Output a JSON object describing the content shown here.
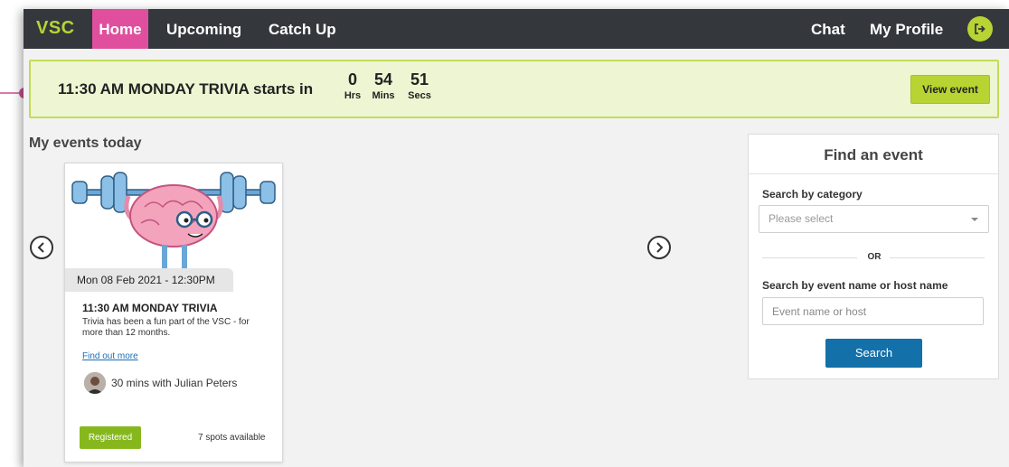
{
  "nav": {
    "logo": "VSC",
    "links": [
      "Home",
      "Upcoming",
      "Catch Up"
    ],
    "right_links": [
      "Chat",
      "My Profile"
    ],
    "logout_icon": "logout-icon",
    "accent_color": "#b7d433",
    "active_color": "#e04f9d"
  },
  "banner": {
    "text": "11:30 AM MONDAY TRIVIA starts in",
    "hours": "0",
    "hours_label": "Hrs",
    "minutes": "54",
    "minutes_label": "Mins",
    "seconds": "51",
    "seconds_label": "Secs",
    "view_button": "View event"
  },
  "events_section": {
    "title": "My events today",
    "prev_icon": "chevron-left-icon",
    "next_icon": "chevron-right-icon",
    "cards": [
      {
        "date": "Mon 08 Feb 2021 - 12:30PM",
        "title": "11:30 AM MONDAY TRIVIA",
        "description": "Trivia has been a fun part of the VSC - for more than 12 months.",
        "link": "Find out more",
        "host": "30 mins with Julian Peters",
        "status": "Registered",
        "spots": "7 spots available",
        "image": "brain-lifting-weights-illustration"
      }
    ]
  },
  "find_event": {
    "title": "Find an event",
    "category_label": "Search by category",
    "category_placeholder": "Please select",
    "or_text": "OR",
    "name_label": "Search by event name or host name",
    "name_placeholder": "Event name or host",
    "search_button": "Search"
  }
}
